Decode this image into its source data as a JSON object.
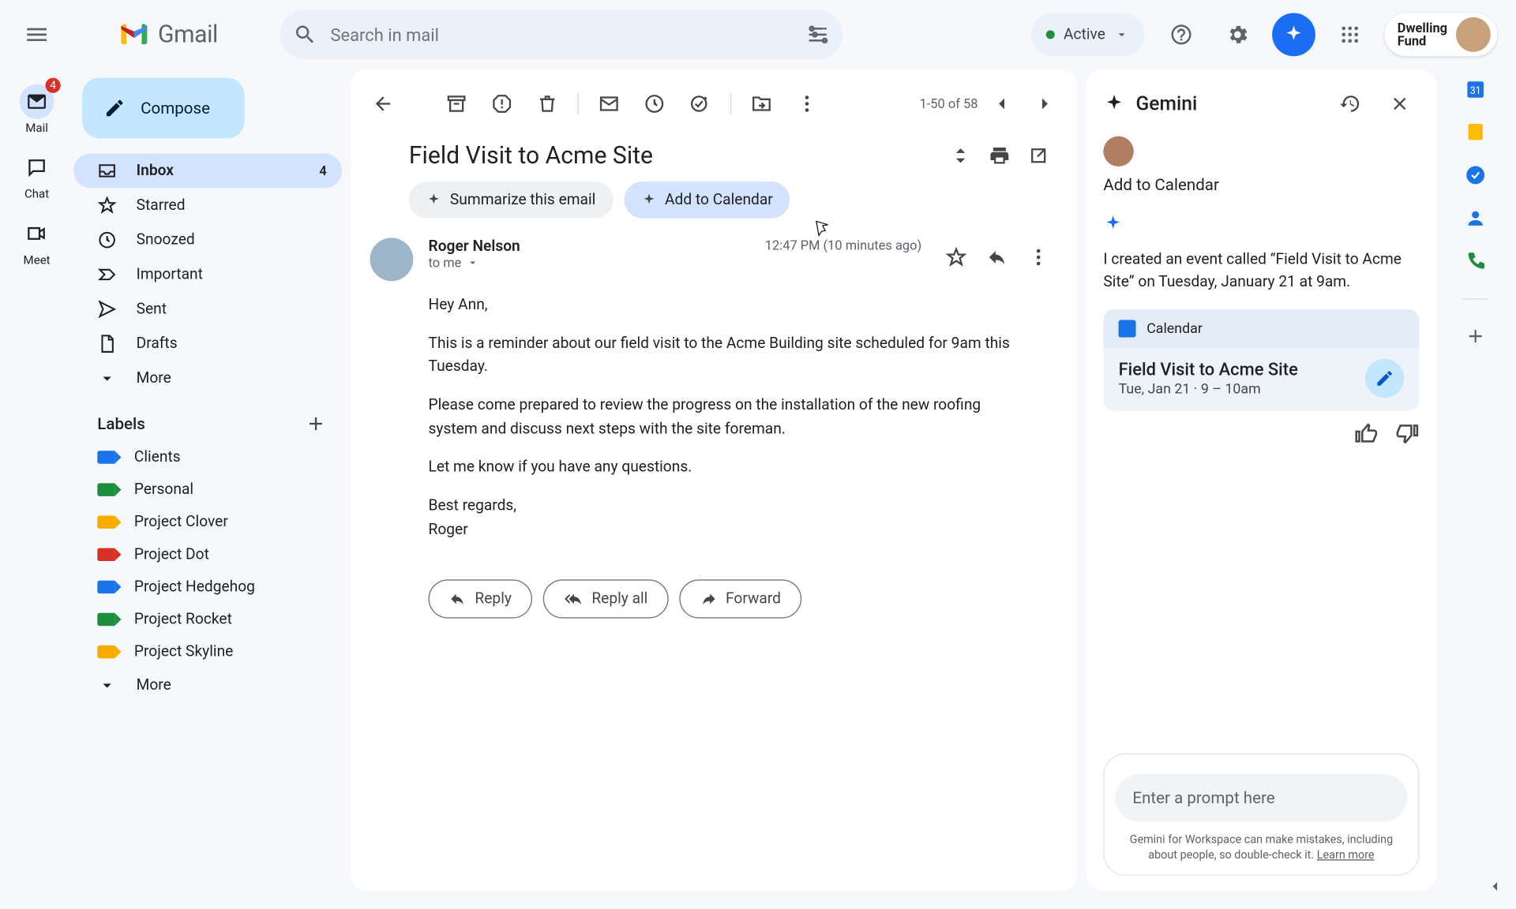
{
  "header": {
    "product": "Gmail",
    "search_placeholder": "Search in mail",
    "status_label": "Active",
    "org_name": "Dwelling\nFund"
  },
  "rail": {
    "mail": "Mail",
    "mail_badge": "4",
    "chat": "Chat",
    "meet": "Meet"
  },
  "sidebar": {
    "compose": "Compose",
    "folders": [
      {
        "key": "inbox",
        "label": "Inbox",
        "count": "4",
        "active": true
      },
      {
        "key": "starred",
        "label": "Starred"
      },
      {
        "key": "snoozed",
        "label": "Snoozed"
      },
      {
        "key": "important",
        "label": "Important"
      },
      {
        "key": "sent",
        "label": "Sent"
      },
      {
        "key": "drafts",
        "label": "Drafts"
      },
      {
        "key": "more",
        "label": "More"
      }
    ],
    "labels_header": "Labels",
    "labels": [
      {
        "label": "Clients",
        "color": "#1a73e8"
      },
      {
        "label": "Personal",
        "color": "#1e8e3e"
      },
      {
        "label": "Project Clover",
        "color": "#f9ab00"
      },
      {
        "label": "Project Dot",
        "color": "#d93025"
      },
      {
        "label": "Project Hedgehog",
        "color": "#1a73e8"
      },
      {
        "label": "Project Rocket",
        "color": "#1e8e3e"
      },
      {
        "label": "Project Skyline",
        "color": "#f9ab00"
      }
    ],
    "labels_more": "More"
  },
  "mail": {
    "pagination": "1-50 of 58",
    "subject": "Field Visit to Acme Site",
    "chip_summarize": "Summarize this email",
    "chip_add_cal": "Add to Calendar",
    "sender": "Roger Nelson",
    "to_line": "to me",
    "timestamp": "12:47 PM (10 minutes ago)",
    "body_p1": "Hey Ann,",
    "body_p2": "This is a reminder about our field visit to the Acme Building site scheduled for 9am this Tuesday.",
    "body_p3": "Please come prepared to review the progress on the installation of the new roofing system and discuss next steps with the site foreman.",
    "body_p4": "Let me know if you have any questions.",
    "body_p5": "Best regards,",
    "body_p6": "Roger",
    "reply": "Reply",
    "reply_all": "Reply all",
    "forward": "Forward"
  },
  "gemini": {
    "title": "Gemini",
    "section": "Add to Calendar",
    "response": "I created an event called “Field Visit to Acme Site” on Tuesday, January 21 at 9am.",
    "card_app": "Calendar",
    "event_title": "Field Visit to Acme Site",
    "event_time": "Tue, Jan 21 · 9 – 10am",
    "prompt_placeholder": "Enter a prompt here",
    "disclaimer": "Gemini for Workspace can make mistakes, including about people, so double-check it.",
    "learn_more": "Learn more"
  }
}
